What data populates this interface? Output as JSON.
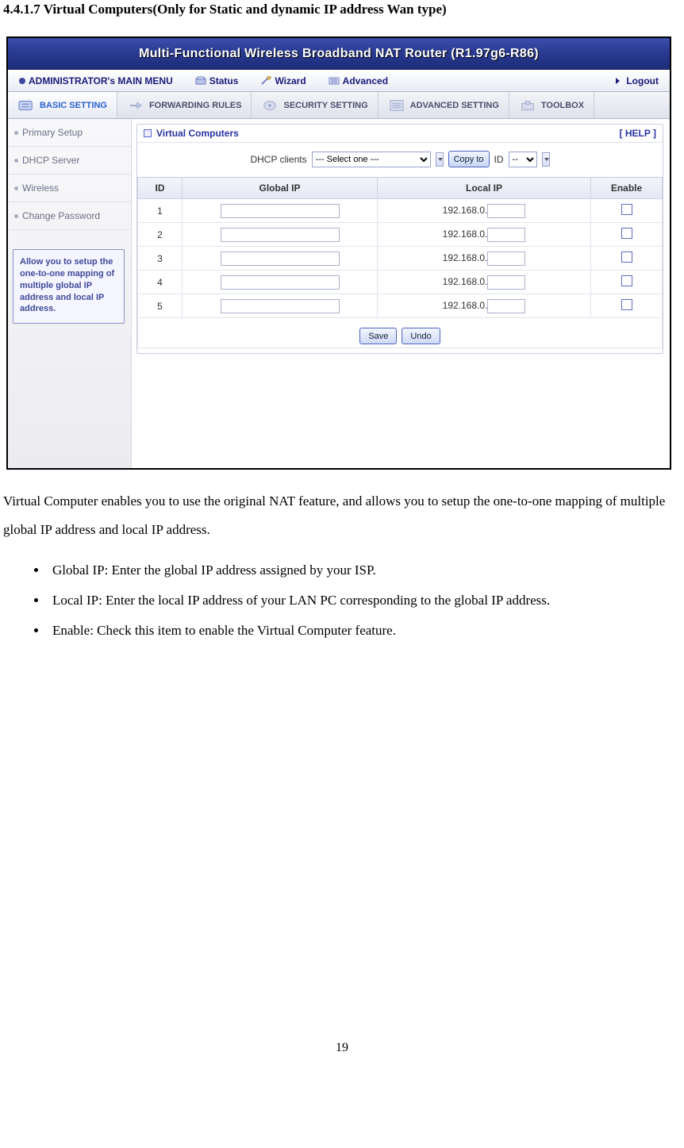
{
  "doc": {
    "section_title": "4.4.1.7 Virtual Computers(Only for Static and dynamic IP address Wan type)",
    "window_title": "Multi-Functional Wireless Broadband NAT Router (R1.97g6-R86)",
    "main_menu_label": "ADMINISTRATOR's MAIN MENU",
    "menu_status": "Status",
    "menu_wizard": "Wizard",
    "menu_advanced": "Advanced",
    "menu_logout": "Logout",
    "tab_basic": "BASIC SETTING",
    "tab_forwarding": "FORWARDING RULES",
    "tab_security": "SECURITY SETTING",
    "tab_advanced": "ADVANCED SETTING",
    "tab_toolbox": "TOOLBOX",
    "side": {
      "primary_setup": "Primary Setup",
      "dhcp_server": "DHCP Server",
      "wireless": "Wireless",
      "change_password": "Change Password"
    },
    "help_box": "Allow you to setup the one-to-one mapping of multiple global IP address and local IP address.",
    "panel_title": "Virtual Computers",
    "help_link": "[ HELP ]",
    "dhcp_clients_label": "DHCP clients",
    "dhcp_select_placeholder": "--- Select one ---",
    "copy_to": "Copy to",
    "id_label": "ID",
    "id_select_placeholder": "--",
    "th_id": "ID",
    "th_global": "Global IP",
    "th_local": "Local IP",
    "th_enable": "Enable",
    "local_prefix": "192.168.0.",
    "rows": [
      "1",
      "2",
      "3",
      "4",
      "5"
    ],
    "save": "Save",
    "undo": "Undo",
    "para": "Virtual Computer enables you to use the original NAT feature, and allows you to setup the one-to-one mapping of multiple global IP address and local IP address.",
    "b1": "Global IP: Enter the global IP address assigned by your ISP.",
    "b2": "Local IP: Enter the local IP address of your LAN PC corresponding to the global IP address.",
    "b3": "Enable: Check this item to enable the Virtual Computer feature.",
    "page_number": "19"
  }
}
